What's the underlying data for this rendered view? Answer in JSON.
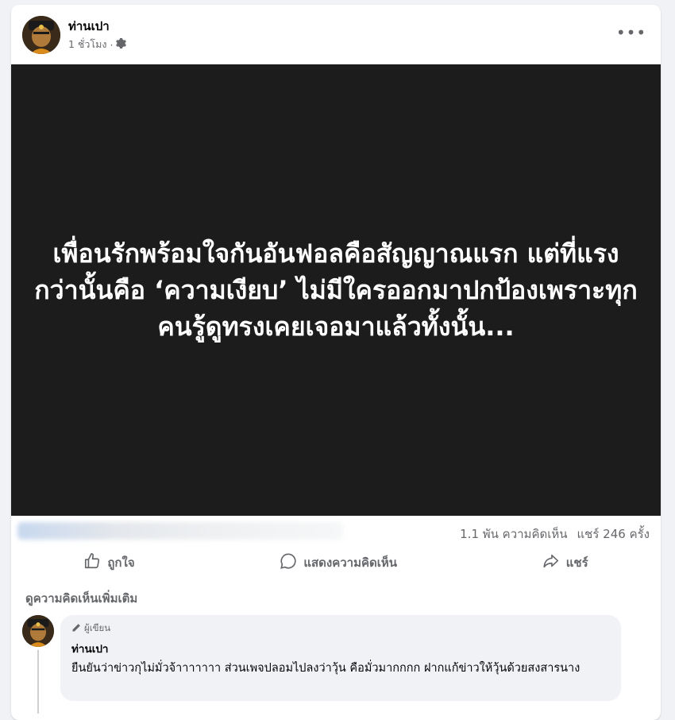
{
  "post": {
    "author": "ท่านเปา",
    "time": "1 ชั่วโมง",
    "separator": "·",
    "more_label": "•••",
    "image_text": "เพื่อนรักพร้อมใจกันอันฟอลคือสัญญาณแรก แต่ที่แรงกว่านั้นคือ ‘ความเงียบ’ ไม่มีใครออกมาปกป้องเพราะทุกคนรู้ดูทรงเคยเจอมาแล้วทั้งนั้น...",
    "comments_count": "1.1 พัน ความคิดเห็น",
    "shares_count": "แชร์ 246 ครั้ง"
  },
  "actions": {
    "like": "ถูกใจ",
    "comment": "แสดงความคิดเห็น",
    "share": "แชร์"
  },
  "more_comments": "ดูความคิดเห็นเพิ่มเติม",
  "comment": {
    "badge": "ผู้เขียน",
    "author": "ท่านเปา",
    "text": "ยืนยันว่าข่าวกุไม่มั่วจ้าาาาาาา ส่วนเพจปลอมไปลงว่าวุ้น คือมั่วมากกกก ฝากแก้ข่าวให้วุ้นด้วยสงสารนาง"
  },
  "icons": {
    "settings": "gear-icon",
    "like": "thumbs-up-icon",
    "comment": "speech-bubble-icon",
    "share": "share-arrow-icon",
    "badge": "pencil-icon"
  },
  "colors": {
    "image_bg": "#1c1c1c",
    "secondary_text": "#65676b",
    "bubble_bg": "#f0f2f5"
  }
}
